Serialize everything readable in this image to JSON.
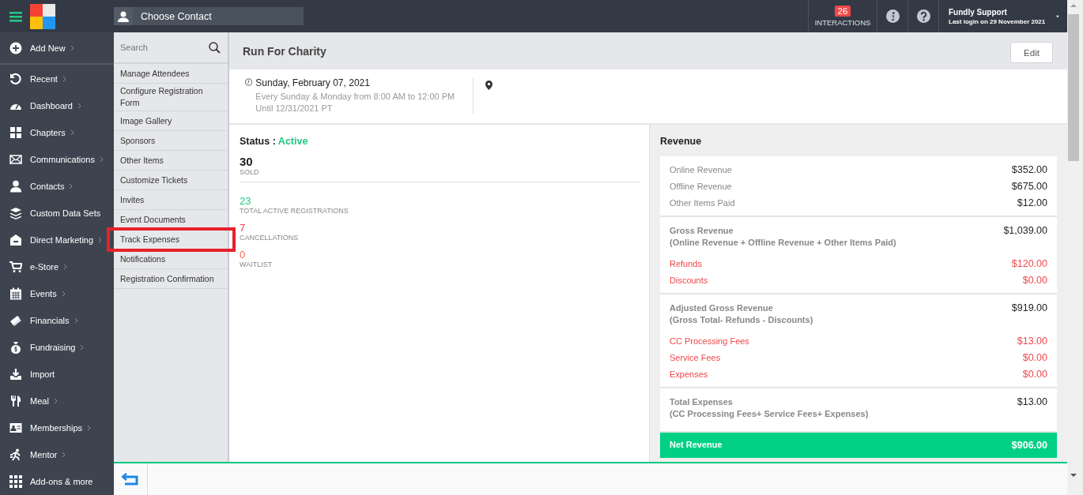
{
  "topbar": {
    "contact_picker": {
      "placeholder": "Choose Contact"
    },
    "interactions": {
      "count": "26",
      "label": "INTERACTIONS"
    },
    "user": {
      "name": "Fundly Support",
      "last_login": "Last login on 29 November 2021"
    }
  },
  "sidebar": {
    "items": [
      {
        "label": "Add New",
        "has_submenu": true
      },
      {
        "label": "Recent",
        "has_submenu": true
      },
      {
        "label": "Dashboard",
        "has_submenu": true
      },
      {
        "label": "Chapters",
        "has_submenu": true
      },
      {
        "label": "Communications",
        "has_submenu": true
      },
      {
        "label": "Contacts",
        "has_submenu": true
      },
      {
        "label": "Custom Data Sets",
        "has_submenu": false
      },
      {
        "label": "Direct Marketing",
        "has_submenu": true
      },
      {
        "label": "e-Store",
        "has_submenu": true
      },
      {
        "label": "Events",
        "has_submenu": true
      },
      {
        "label": "Financials",
        "has_submenu": true
      },
      {
        "label": "Fundraising",
        "has_submenu": true
      },
      {
        "label": "Import",
        "has_submenu": false
      },
      {
        "label": "Meal",
        "has_submenu": true
      },
      {
        "label": "Memberships",
        "has_submenu": true
      },
      {
        "label": "Mentor",
        "has_submenu": true
      },
      {
        "label": "Add-ons & more",
        "has_submenu": false
      }
    ]
  },
  "submenu": {
    "search": {
      "placeholder": "Search"
    },
    "items": [
      {
        "label": "Manage Attendees",
        "highlighted": false
      },
      {
        "label": "Configure Registration Form",
        "highlighted": false
      },
      {
        "label": "Image Gallery",
        "highlighted": false
      },
      {
        "label": "Sponsors",
        "highlighted": false
      },
      {
        "label": "Other Items",
        "highlighted": false
      },
      {
        "label": "Customize Tickets",
        "highlighted": false
      },
      {
        "label": "Invites",
        "highlighted": false
      },
      {
        "label": "Event Documents",
        "highlighted": false
      },
      {
        "label": "Track Expenses",
        "highlighted": true
      },
      {
        "label": "Notifications",
        "highlighted": false
      },
      {
        "label": "Registration Confirmation",
        "highlighted": false
      }
    ]
  },
  "event": {
    "title": "Run For Charity",
    "edit_button": "Edit",
    "date": "Sunday, February 07, 2021",
    "recurrence": "Every Sunday & Monday from 8:00 AM to 12:00 PM Until 12/31/2021 PT",
    "status_label": "Status :",
    "status": "Active",
    "sold": {
      "value": "30",
      "label": "SOLD"
    },
    "stats": [
      {
        "value": "23",
        "label": "TOTAL ACTIVE REGISTRATIONS",
        "color": "#22c983"
      },
      {
        "value": "7",
        "label": "CANCELLATIONS",
        "color": "#f0474a"
      },
      {
        "value": "0",
        "label": "WAITLIST",
        "color": "#f7684a"
      }
    ]
  },
  "revenue": {
    "title": "Revenue",
    "sections": [
      {
        "rows": [
          {
            "kind": "plain",
            "label": "Online Revenue",
            "amount": "$352.00"
          },
          {
            "kind": "plain",
            "label": "Offline Revenue",
            "amount": "$675.00"
          },
          {
            "kind": "plain",
            "label": "Other Items Paid",
            "amount": "$12.00"
          }
        ]
      },
      {
        "rows": [
          {
            "kind": "total",
            "label": "Gross Revenue",
            "formula": "(Online Revenue + Offline Revenue + Other Items Paid)",
            "amount": "$1,039.00"
          },
          {
            "kind": "deduction",
            "label": "Refunds",
            "amount": "$120.00"
          },
          {
            "kind": "deduction",
            "label": "Discounts",
            "amount": "$0.00"
          }
        ]
      },
      {
        "rows": [
          {
            "kind": "total",
            "label": "Adjusted Gross Revenue",
            "formula": "(Gross Total- Refunds - Discounts)",
            "amount": "$919.00"
          },
          {
            "kind": "deduction",
            "label": "CC Processing Fees",
            "amount": "$13.00"
          },
          {
            "kind": "deduction",
            "label": "Service Fees",
            "amount": "$0.00"
          },
          {
            "kind": "deduction",
            "label": "Expenses",
            "amount": "$0.00"
          }
        ]
      },
      {
        "rows": [
          {
            "kind": "total",
            "label": "Total Expenses",
            "formula": "(CC Processing Fees+ Service Fees+ Expenses)",
            "amount": "$13.00"
          }
        ]
      }
    ],
    "net": {
      "label": "Net Revenue",
      "amount": "$906.00"
    }
  }
}
